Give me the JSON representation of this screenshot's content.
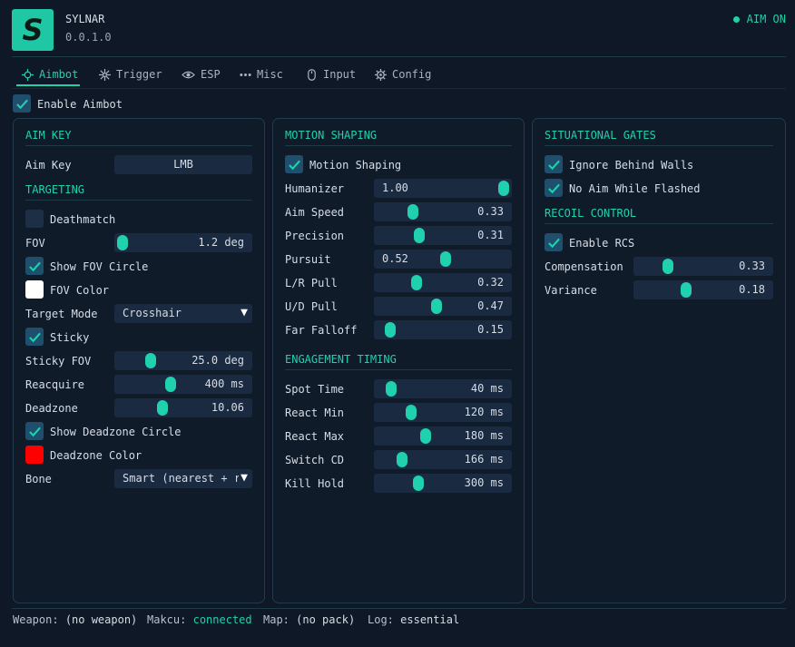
{
  "header": {
    "logo_letter": "S",
    "app_name": "SYLNAR",
    "version": "0.0.1.0",
    "status": "AIM ON"
  },
  "tabs": [
    "Aimbot",
    "Trigger",
    "ESP",
    "Misc",
    "Input",
    "Config"
  ],
  "enable_aimbot": {
    "label": "Enable Aimbot",
    "checked": true
  },
  "left": {
    "aim_key_title": "AIM KEY",
    "aim_key_label": "Aim Key",
    "aim_key_value": "LMB",
    "targeting_title": "TARGETING",
    "deathmatch": "Deathmatch",
    "fov_label": "FOV",
    "fov_value": "1.2 deg",
    "show_fov_circle": "Show FOV Circle",
    "fov_color": "FOV Color",
    "target_mode_label": "Target Mode",
    "target_mode_value": "Crosshair",
    "sticky": "Sticky",
    "sticky_fov_label": "Sticky FOV",
    "sticky_fov_value": "25.0 deg",
    "reacquire_label": "Reacquire",
    "reacquire_value": "400 ms",
    "deadzone_label": "Deadzone",
    "deadzone_value": "10.06",
    "show_deadzone_circle": "Show Deadzone Circle",
    "deadzone_color": "Deadzone Color",
    "bone_label": "Bone",
    "bone_value": "Smart (nearest + r"
  },
  "middle": {
    "motion_title": "MOTION SHAPING",
    "motion_shaping": "Motion Shaping",
    "humanizer_label": "Humanizer",
    "humanizer_value": "1.00",
    "aim_speed_label": "Aim Speed",
    "aim_speed_value": "0.33",
    "precision_label": "Precision",
    "precision_value": "0.31",
    "pursuit_label": "Pursuit",
    "pursuit_value": "0.52",
    "lr_pull_label": "L/R Pull",
    "lr_pull_value": "0.32",
    "ud_pull_label": "U/D Pull",
    "ud_pull_value": "0.47",
    "far_falloff_label": "Far Falloff",
    "far_falloff_value": "0.15",
    "timing_title": "ENGAGEMENT TIMING",
    "spot_time_label": "Spot Time",
    "spot_time_value": "40 ms",
    "react_min_label": "React Min",
    "react_min_value": "120 ms",
    "react_max_label": "React Max",
    "react_max_value": "180 ms",
    "switch_cd_label": "Switch CD",
    "switch_cd_value": "166 ms",
    "kill_hold_label": "Kill Hold",
    "kill_hold_value": "300 ms"
  },
  "right": {
    "gates_title": "SITUATIONAL GATES",
    "ignore_behind_walls": "Ignore Behind Walls",
    "no_aim_while_flashed": "No Aim While Flashed",
    "recoil_title": "RECOIL CONTROL",
    "enable_rcs": "Enable RCS",
    "compensation_label": "Compensation",
    "compensation_value": "0.33",
    "variance_label": "Variance",
    "variance_value": "0.18"
  },
  "footer": {
    "weapon_label": "Weapon:",
    "weapon_value": "(no weapon)",
    "makcu_label": "Makcu:",
    "makcu_value": "connected",
    "map_label": "Map:",
    "map_value": "(no pack)",
    "log_label": "Log:",
    "log_value": "essential"
  },
  "colors": {
    "accent": "#1fd1ad",
    "fov_color": "#ffffff",
    "deadzone_color": "#ff0000",
    "background": "#0e1826"
  }
}
